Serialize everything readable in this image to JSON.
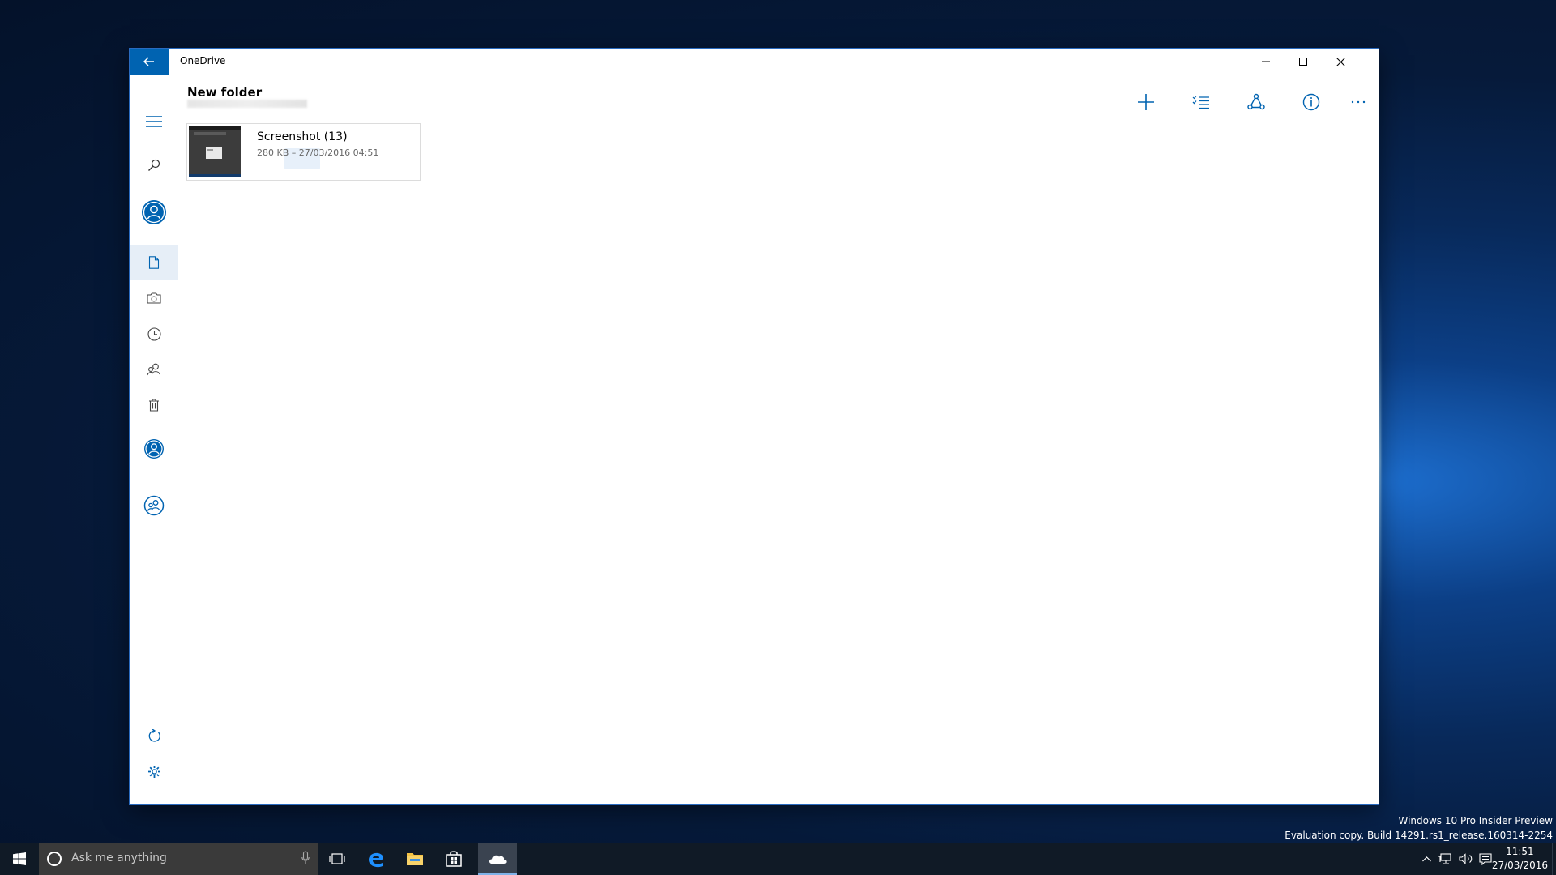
{
  "window": {
    "title": "OneDrive",
    "controls": [
      "minimize",
      "maximize",
      "close"
    ]
  },
  "nav": {
    "items": [
      {
        "id": "menu",
        "icon": "hamburger-icon"
      },
      {
        "id": "search",
        "icon": "search-icon"
      },
      {
        "id": "account",
        "icon": "account-icon"
      },
      {
        "id": "files",
        "icon": "file-icon",
        "selected": true
      },
      {
        "id": "photos",
        "icon": "camera-icon"
      },
      {
        "id": "recent",
        "icon": "clock-icon"
      },
      {
        "id": "shared",
        "icon": "people-icon"
      },
      {
        "id": "recycle-bin",
        "icon": "trash-icon"
      },
      {
        "id": "account-personal",
        "icon": "account-icon"
      },
      {
        "id": "account-business",
        "icon": "business-account-icon"
      },
      {
        "id": "refresh",
        "icon": "refresh-icon"
      },
      {
        "id": "settings",
        "icon": "gear-icon"
      }
    ]
  },
  "header": {
    "folder_title": "New folder"
  },
  "commands": [
    {
      "id": "add",
      "icon": "plus-icon"
    },
    {
      "id": "select",
      "icon": "checklist-icon"
    },
    {
      "id": "share",
      "icon": "share-icon"
    },
    {
      "id": "info",
      "icon": "info-icon"
    },
    {
      "id": "more",
      "icon": "more-icon"
    }
  ],
  "files": [
    {
      "name": "Screenshot (13)",
      "meta": "280 KB – 27/03/2016 04:51"
    }
  ],
  "watermark": {
    "line1": "Windows 10 Pro Insider Preview",
    "line2": "Evaluation copy. Build 14291.rs1_release.160314-2254"
  },
  "taskbar": {
    "search_placeholder": "Ask me anything",
    "time": "11:51",
    "date": "27/03/2016"
  },
  "colors": {
    "accent": "#0063b1",
    "taskbar": "#101a26",
    "selected_rail": "#e6eef7"
  }
}
